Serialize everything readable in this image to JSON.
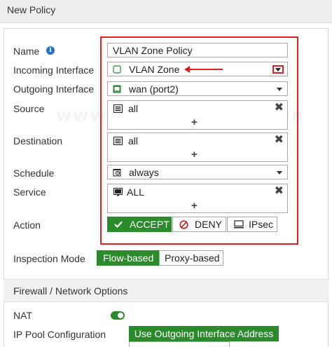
{
  "dialog": {
    "title": "New Policy"
  },
  "watermark": "www.techingarticles.in",
  "form": {
    "name": {
      "label": "Name",
      "value": "VLAN Zone Policy"
    },
    "incoming": {
      "label": "Incoming Interface",
      "value": "VLAN Zone"
    },
    "outgoing": {
      "label": "Outgoing Interface",
      "value": "wan (port2)"
    },
    "source": {
      "label": "Source",
      "value": "all",
      "add": "+",
      "remove": "✖"
    },
    "destination": {
      "label": "Destination",
      "value": "all",
      "add": "+",
      "remove": "✖"
    },
    "schedule": {
      "label": "Schedule",
      "value": "always"
    },
    "service": {
      "label": "Service",
      "value": "ALL",
      "add": "+",
      "remove": "✖"
    },
    "action": {
      "label": "Action",
      "options": [
        "ACCEPT",
        "DENY",
        "IPsec"
      ],
      "selected": "ACCEPT"
    },
    "inspection": {
      "label": "Inspection Mode",
      "options": [
        "Flow-based",
        "Proxy-based"
      ],
      "selected": "Flow-based"
    }
  },
  "firewall": {
    "section_title": "Firewall / Network Options",
    "nat": {
      "label": "NAT",
      "enabled": true
    },
    "ip_pool": {
      "label": "IP Pool Configuration",
      "option": "Use Outgoing Interface Address"
    }
  },
  "colors": {
    "accent_green": "#2b8a2b",
    "highlight_red": "#e0201f",
    "info_blue": "#2a72c6"
  }
}
